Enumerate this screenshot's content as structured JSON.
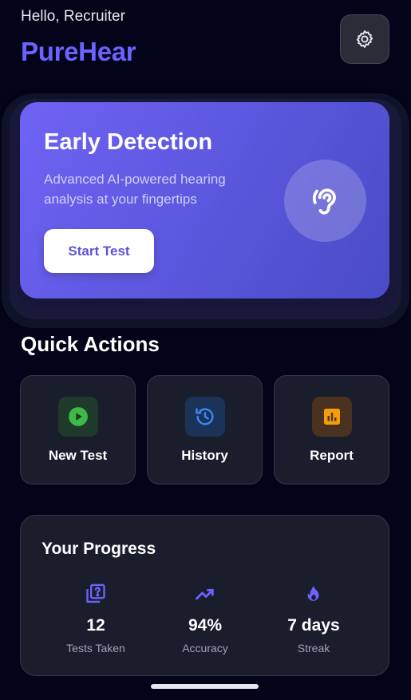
{
  "header": {
    "greeting": "Hello, Recruiter",
    "app_name": "PureHear",
    "settings_icon": "gear-icon"
  },
  "hero": {
    "title": "Early Detection",
    "subtitle": "Advanced AI-powered hearing analysis at your fingertips",
    "button_label": "Start Test",
    "icon": "ear-icon"
  },
  "quick_actions": {
    "title": "Quick Actions",
    "items": [
      {
        "label": "New Test",
        "icon": "play-icon",
        "color": "#3fb84a"
      },
      {
        "label": "History",
        "icon": "history-icon",
        "color": "#3b82f6"
      },
      {
        "label": "Report",
        "icon": "bar-chart-icon",
        "color": "#f59e0b"
      }
    ]
  },
  "progress": {
    "title": "Your Progress",
    "stats": [
      {
        "value": "12",
        "label": "Tests Taken",
        "icon": "quiz-icon"
      },
      {
        "value": "94%",
        "label": "Accuracy",
        "icon": "trending-up-icon"
      },
      {
        "value": "7 days",
        "label": "Streak",
        "icon": "flame-icon"
      }
    ]
  },
  "colors": {
    "accent": "#6c63ff",
    "background": "#03031a",
    "card": "#1a1d2b"
  }
}
